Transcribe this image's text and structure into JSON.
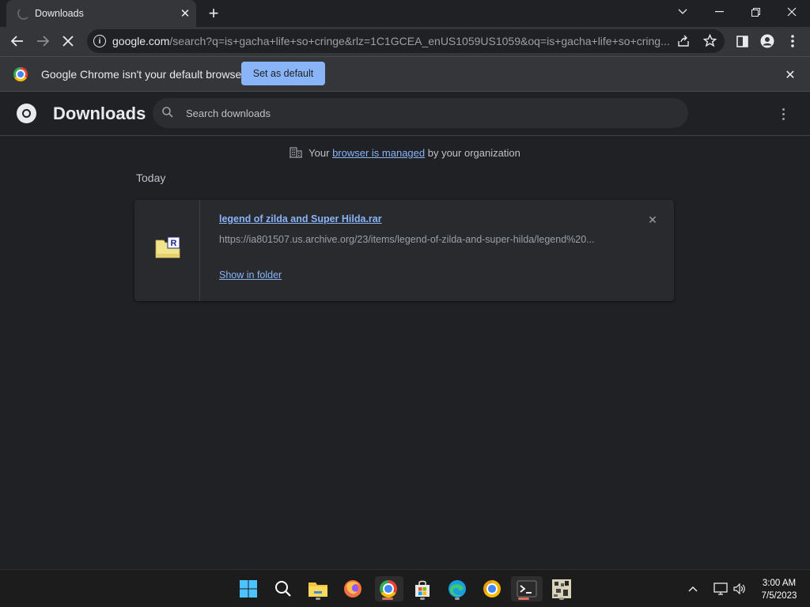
{
  "tab": {
    "title": "Downloads",
    "close": "✕",
    "new_tab": "+"
  },
  "window": {
    "minimize": "—",
    "maximize": "❐",
    "close": "✕",
    "tab_search": "⌄"
  },
  "toolbar": {
    "url_host": "google.com",
    "url_rest": "/search?q=is+gacha+life+so+cringe&rlz=1C1GCEA_enUS1059US1059&oq=is+gacha+life+so+cring..."
  },
  "infobar": {
    "message": "Google Chrome isn't your default browser",
    "button": "Set as default",
    "close": "✕"
  },
  "downloads": {
    "title": "Downloads",
    "search_placeholder": "Search downloads",
    "managed_prefix": "Your ",
    "managed_link": "browser is managed",
    "managed_suffix": " by your organization",
    "section_date": "Today",
    "items": [
      {
        "file_name": "legend of zilda and Super Hilda.rar",
        "url": "https://ia801507.us.archive.org/23/items/legend-of-zilda-and-super-hilda/legend%20...",
        "action": "Show in folder",
        "remove": "✕"
      }
    ]
  },
  "taskbar": {
    "time": "3:00 AM",
    "date": "7/5/2023"
  },
  "colors": {
    "accent": "#8ab4f8",
    "background": "#202124",
    "toolbar": "#35363a"
  }
}
